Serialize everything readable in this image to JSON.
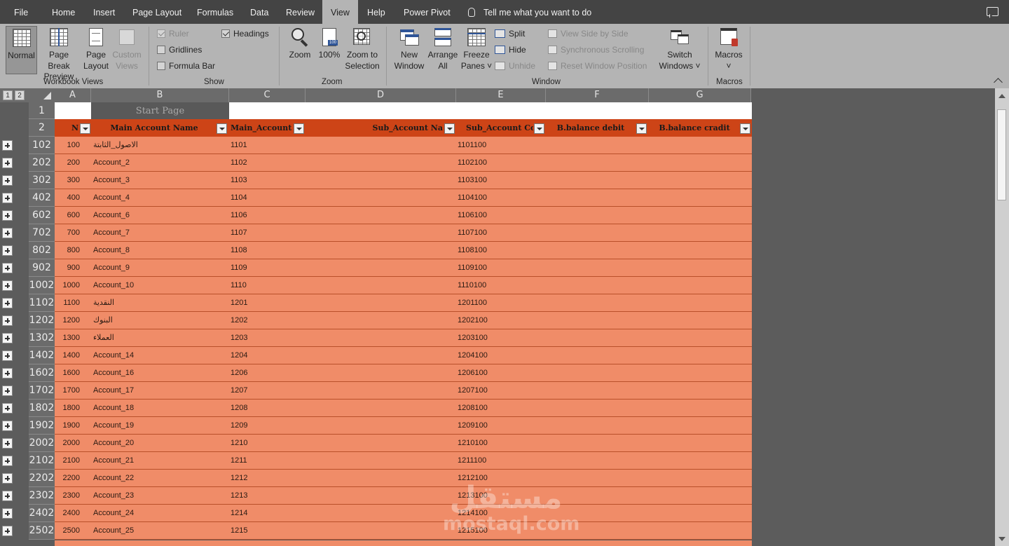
{
  "tabs": [
    {
      "label": "File",
      "active": false
    },
    {
      "label": "Home",
      "active": false
    },
    {
      "label": "Insert",
      "active": false
    },
    {
      "label": "Page Layout",
      "active": false
    },
    {
      "label": "Formulas",
      "active": false
    },
    {
      "label": "Data",
      "active": false
    },
    {
      "label": "Review",
      "active": false
    },
    {
      "label": "View",
      "active": true
    },
    {
      "label": "Help",
      "active": false
    },
    {
      "label": "Power Pivot",
      "active": false
    }
  ],
  "tell_me": "Tell me what you want to do",
  "ribbon": {
    "workbook_views": {
      "label": "Workbook Views",
      "normal": "Normal",
      "page_break_1": "Page Break",
      "page_break_2": "Preview",
      "page_layout_1": "Page",
      "page_layout_2": "Layout",
      "custom_1": "Custom",
      "custom_2": "Views"
    },
    "show": {
      "label": "Show",
      "ruler": "Ruler",
      "gridlines": "Gridlines",
      "formula_bar": "Formula Bar",
      "headings": "Headings",
      "ruler_checked": true,
      "gridlines_checked": false,
      "formula_bar_checked": false,
      "headings_checked": true
    },
    "zoom": {
      "label": "Zoom",
      "zoom": "Zoom",
      "hundred": "100%",
      "zoom_sel_1": "Zoom to",
      "zoom_sel_2": "Selection"
    },
    "window": {
      "label": "Window",
      "new_1": "New",
      "new_2": "Window",
      "arrange_1": "Arrange",
      "arrange_2": "All",
      "freeze_1": "Freeze",
      "freeze_2": "Panes ˅",
      "split": "Split",
      "hide": "Hide",
      "unhide": "Unhide",
      "view_side": "View Side by Side",
      "sync_scroll": "Synchronous Scrolling",
      "reset_pos": "Reset Window Position",
      "switch_1": "Switch",
      "switch_2": "Windows ˅"
    },
    "macros": {
      "label": "Macros",
      "macros": "Macros",
      "arrow": "˅"
    }
  },
  "sheet": {
    "outline_levels": [
      "1",
      "2"
    ],
    "columns": [
      "A",
      "B",
      "C",
      "D",
      "E",
      "F",
      "G"
    ],
    "row_headers_top": [
      "1",
      "2"
    ],
    "start_page": "Start Page",
    "table_headers": {
      "n": "N",
      "main_account_name": "Main Account Name",
      "main_account_code": "Main_Account Co",
      "sub_account_name": "Sub_Account Na",
      "sub_account_code": "Sub_Account Cod",
      "balance_debit": "B.balance debit",
      "balance_credit": "B.balance cradit"
    },
    "rows": [
      {
        "rownum": "102",
        "n": "100",
        "name": "الاصول_الثابتة",
        "code": "1101",
        "sub": "1101100"
      },
      {
        "rownum": "202",
        "n": "200",
        "name": "Account_2",
        "code": "1102",
        "sub": "1102100"
      },
      {
        "rownum": "302",
        "n": "300",
        "name": "Account_3",
        "code": "1103",
        "sub": "1103100"
      },
      {
        "rownum": "402",
        "n": "400",
        "name": "Account_4",
        "code": "1104",
        "sub": "1104100"
      },
      {
        "rownum": "602",
        "n": "600",
        "name": "Account_6",
        "code": "1106",
        "sub": "1106100"
      },
      {
        "rownum": "702",
        "n": "700",
        "name": "Account_7",
        "code": "1107",
        "sub": "1107100"
      },
      {
        "rownum": "802",
        "n": "800",
        "name": "Account_8",
        "code": "1108",
        "sub": "1108100"
      },
      {
        "rownum": "902",
        "n": "900",
        "name": "Account_9",
        "code": "1109",
        "sub": "1109100"
      },
      {
        "rownum": "1002",
        "n": "1000",
        "name": "Account_10",
        "code": "1110",
        "sub": "1110100"
      },
      {
        "rownum": "1102",
        "n": "1100",
        "name": "النقدية",
        "code": "1201",
        "sub": "1201100"
      },
      {
        "rownum": "1202",
        "n": "1200",
        "name": "البنوك",
        "code": "1202",
        "sub": "1202100"
      },
      {
        "rownum": "1302",
        "n": "1300",
        "name": "العملاء",
        "code": "1203",
        "sub": "1203100"
      },
      {
        "rownum": "1402",
        "n": "1400",
        "name": "Account_14",
        "code": "1204",
        "sub": "1204100"
      },
      {
        "rownum": "1602",
        "n": "1600",
        "name": "Account_16",
        "code": "1206",
        "sub": "1206100"
      },
      {
        "rownum": "1702",
        "n": "1700",
        "name": "Account_17",
        "code": "1207",
        "sub": "1207100"
      },
      {
        "rownum": "1802",
        "n": "1800",
        "name": "Account_18",
        "code": "1208",
        "sub": "1208100"
      },
      {
        "rownum": "1902",
        "n": "1900",
        "name": "Account_19",
        "code": "1209",
        "sub": "1209100"
      },
      {
        "rownum": "2002",
        "n": "2000",
        "name": "Account_20",
        "code": "1210",
        "sub": "1210100"
      },
      {
        "rownum": "2102",
        "n": "2100",
        "name": "Account_21",
        "code": "1211",
        "sub": "1211100"
      },
      {
        "rownum": "2202",
        "n": "2200",
        "name": "Account_22",
        "code": "1212",
        "sub": "1212100"
      },
      {
        "rownum": "2302",
        "n": "2300",
        "name": "Account_23",
        "code": "1213",
        "sub": "1213100"
      },
      {
        "rownum": "2402",
        "n": "2400",
        "name": "Account_24",
        "code": "1214",
        "sub": "1214100"
      },
      {
        "rownum": "2502",
        "n": "2500",
        "name": "Account_25",
        "code": "1215",
        "sub": "1215100"
      }
    ]
  },
  "watermark": {
    "arabic": "مستقل",
    "latin": "mostaql.com"
  },
  "colors": {
    "header_fill": "#cd4417",
    "row_fill": "#f08c68",
    "app_bg": "#5a5a5a"
  }
}
